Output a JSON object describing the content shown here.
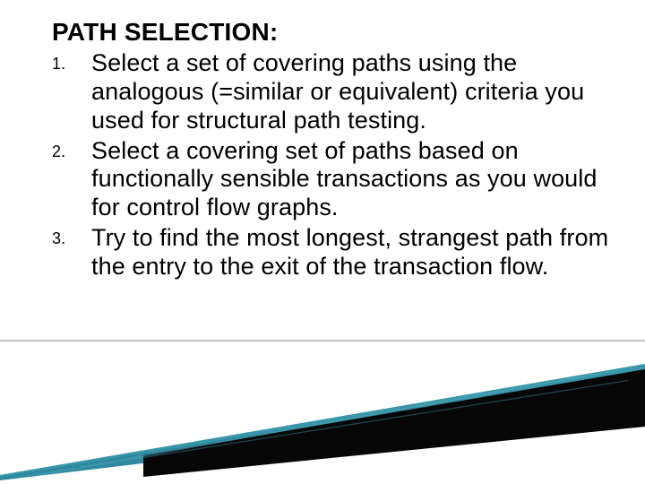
{
  "heading": "PATH SELECTION:",
  "items": [
    {
      "num": "1.",
      "text": "Select a set of covering paths using the analogous (=similar or equivalent) criteria you used for structural path testing."
    },
    {
      "num": "2.",
      "text": " Select a covering set of paths based on functionally sensible transactions as you would for control flow graphs."
    },
    {
      "num": "3.",
      "text": "Try to find the most  longest, strangest path from the entry to the exit of the transaction flow."
    }
  ]
}
